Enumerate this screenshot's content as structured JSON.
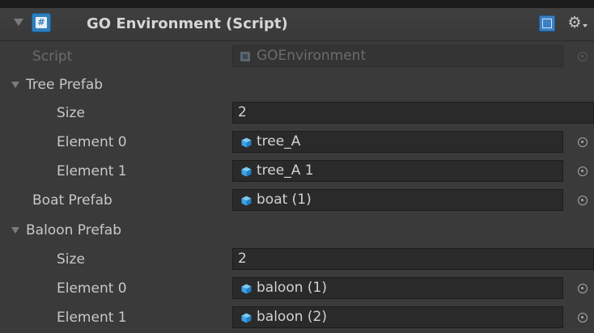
{
  "component": {
    "title": "GO Environment (Script)",
    "icons": {
      "foldout": "foldout-expanded-icon",
      "script": "csharp-script-icon",
      "help": "help-book-icon",
      "settings": "gear-icon"
    }
  },
  "fields": {
    "script": {
      "label": "Script",
      "value": "GOEnvironment",
      "icon": "script-asset-icon"
    },
    "tree_prefab": {
      "label": "Tree Prefab",
      "size_label": "Size",
      "size_value": "2",
      "elements": [
        {
          "label": "Element 0",
          "value": "tree_A"
        },
        {
          "label": "Element 1",
          "value": "tree_A 1"
        }
      ]
    },
    "boat_prefab": {
      "label": "Boat Prefab",
      "value": "boat (1)"
    },
    "baloon_prefab": {
      "label": "Baloon Prefab",
      "size_label": "Size",
      "size_value": "2",
      "elements": [
        {
          "label": "Element 0",
          "value": "baloon (1)"
        },
        {
          "label": "Element 1",
          "value": "baloon (2)"
        }
      ]
    }
  },
  "colors": {
    "panel_bg": "#3a3a3a",
    "field_bg": "#2a2a2a",
    "text": "#c8c8c8",
    "disabled_text": "#6c6c6c",
    "prefab_cube": "#3ea3e6"
  }
}
